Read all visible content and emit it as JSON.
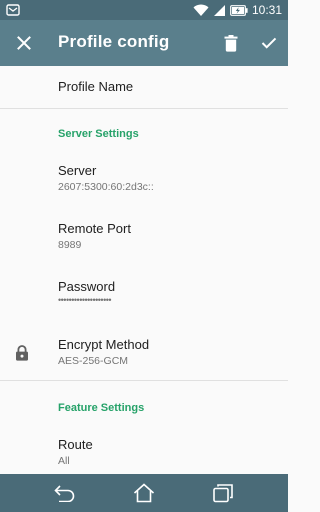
{
  "status_bar": {
    "time": "10:31",
    "icons": [
      "notification-icon",
      "wifi-icon",
      "signal-icon",
      "battery-charging-icon"
    ]
  },
  "app_bar": {
    "title": "Profile config",
    "icons": [
      "close-icon",
      "delete-icon",
      "check-icon"
    ]
  },
  "prefs": {
    "profile_name": {
      "label": "Profile Name"
    },
    "server_section": "Server Settings",
    "server": {
      "label": "Server",
      "value": "2607:5300:60:2d3c::"
    },
    "remote_port": {
      "label": "Remote Port",
      "value": "8989"
    },
    "password": {
      "label": "Password",
      "value": "••••••••••••••••••••"
    },
    "encrypt_method": {
      "label": "Encrypt Method",
      "value": "AES-256-GCM",
      "icon": "lock-icon"
    },
    "feature_section": "Feature Settings",
    "route": {
      "label": "Route",
      "value": "All"
    }
  },
  "nav_bar": {
    "icons": [
      "back-icon",
      "home-icon",
      "recents-icon"
    ]
  },
  "colors": {
    "status_bar": "#4a6b78",
    "app_bar": "#5a7f8c",
    "accent": "#26a269",
    "background": "#fafafa"
  }
}
